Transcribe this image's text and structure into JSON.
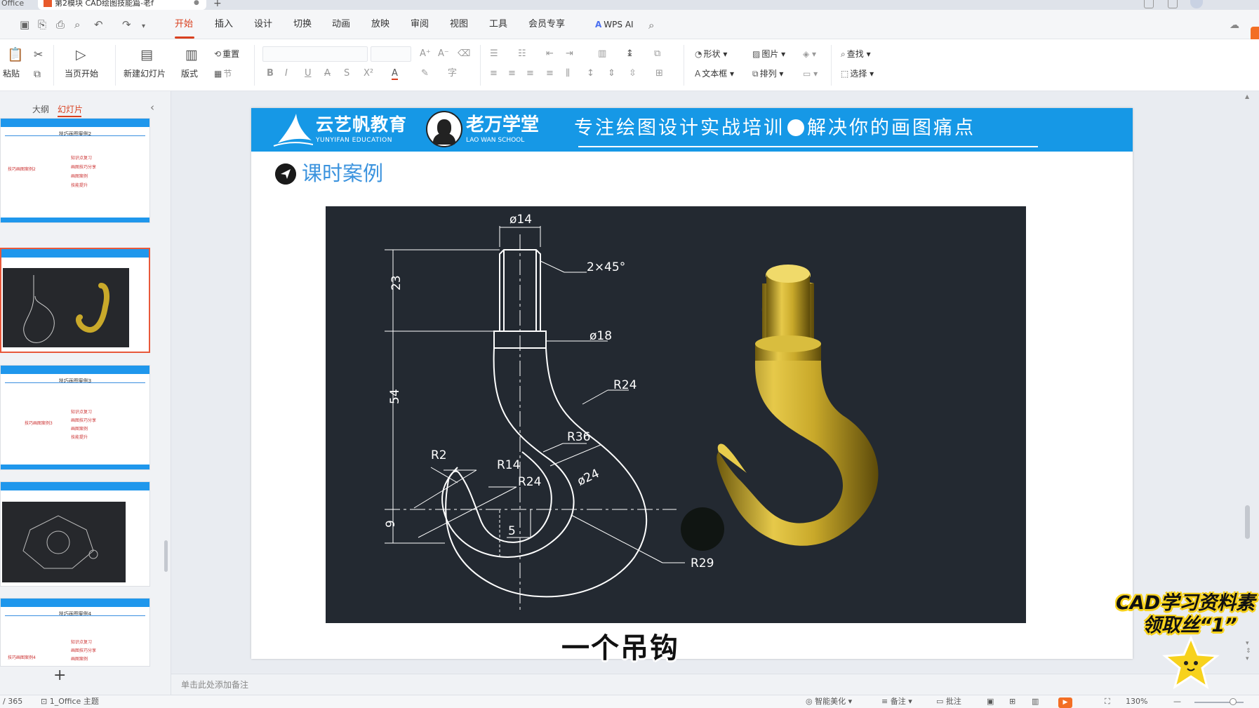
{
  "titlebar": {
    "app_name": "Office",
    "doc_tab": "第2模块 CAD绘图技能篇-老f",
    "close_glyph": "●",
    "new_tab": "+"
  },
  "menu": {
    "tabs": [
      "开始",
      "插入",
      "设计",
      "切换",
      "动画",
      "放映",
      "审阅",
      "视图",
      "工具",
      "会员专享"
    ],
    "active_tab": "开始",
    "wps_ai": "WPS AI"
  },
  "ribbon": {
    "paste": "粘贴",
    "from_current": "当页开始",
    "new_slide": "新建幻灯片",
    "layout": "版式",
    "reset": "重置",
    "section": "节",
    "shape": "形状",
    "picture": "图片",
    "textbox": "文本框",
    "arrange": "排列",
    "find": "查找",
    "select": "选择",
    "format_glyphs": [
      "B",
      "I",
      "U",
      "A",
      "S",
      "X²",
      "A"
    ]
  },
  "left_panel": {
    "tab_outline": "大纲",
    "tab_slides": "幻灯片",
    "add_slide": "+",
    "thumbnails": [
      {
        "title": "技巧画图案例2",
        "items": [
          "知识点复习",
          "画图技巧分享",
          "画图案例",
          "技能提升"
        ],
        "left_label": "技巧画图案例2"
      },
      {
        "title": "",
        "items": [],
        "left_label": ""
      },
      {
        "title": "技巧画图案例3",
        "items": [
          "知识点复习",
          "画图技巧分享",
          "画图案例",
          "技能提升"
        ],
        "left_label": "技巧画图案例3"
      },
      {
        "title": "",
        "items": [],
        "left_label": ""
      },
      {
        "title": "技巧画图案例4",
        "items": [
          "知识点复习",
          "画图技巧分享",
          "画图案例"
        ],
        "left_label": "技巧画图案例4"
      }
    ]
  },
  "slide": {
    "brand_cn": "云艺帆教育",
    "brand_en": "YUNYIFAN EDUCATION",
    "school_cn": "老万学堂",
    "school_en": "LAO WAN SCHOOL",
    "slogan_left": "专注绘图设计实战培训",
    "slogan_right": "解决你的画图痛点",
    "section_title": "课时案例"
  },
  "drawing": {
    "dims": {
      "d14": "ø14",
      "chamfer": "2×45°",
      "d18": "ø18",
      "r24_top": "R24",
      "r36": "R36",
      "r2": "R2",
      "r14": "R14",
      "r24_inner": "R24",
      "d24": "ø24",
      "five": "5",
      "r29": "R29",
      "v23": "23",
      "v54": "54",
      "v9": "9"
    },
    "hook_color": "#c9a92a"
  },
  "notes_placeholder": "单击此处添加备注",
  "status": {
    "slide_count": "/ 365",
    "theme": "1_Office 主题",
    "smart": "智能美化",
    "notes": "备注",
    "comments": "批注",
    "zoom": "130%"
  },
  "overlay": {
    "caption": "一个吊钩",
    "promo_line1": "CAD学习资料素",
    "promo_line2": "领取丝“1”"
  }
}
